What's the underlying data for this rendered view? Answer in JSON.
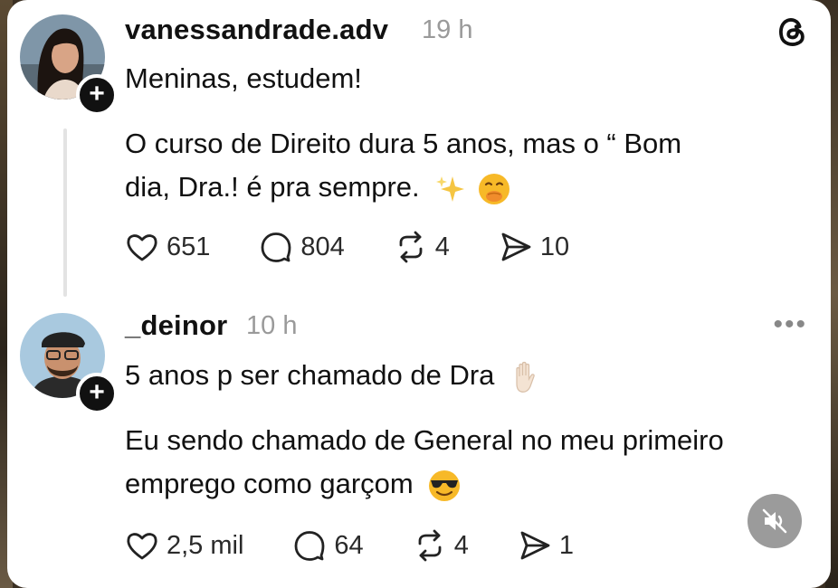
{
  "post": {
    "username": "vanessandrade.adv",
    "time": "19 h",
    "line1": "Meninas, estudem!",
    "line2": "O curso de Direito dura 5 anos, mas o “ Bom",
    "line3": "dia, Dra.! é pra sempre.",
    "likes": "651",
    "replies": "804",
    "reposts": "4",
    "shares": "10"
  },
  "reply": {
    "username": "_deinor",
    "time": "10 h",
    "line1": "5 anos p ser chamado de Dra",
    "line2": "Eu sendo chamado de General no meu primeiro",
    "line3": "emprego como garçom",
    "likes": "2,5 mil",
    "replies": "64",
    "reposts": "4",
    "shares": "1"
  },
  "icons": {
    "like": "heart-icon",
    "reply": "comment-icon",
    "repost": "repost-icon",
    "share": "share-icon",
    "logo": "threads-logo-icon",
    "more": "more-icon",
    "mute": "muted-speaker-icon"
  },
  "colors": {
    "text": "#111111",
    "muted": "#9a9a9a",
    "badge": "#111111"
  }
}
